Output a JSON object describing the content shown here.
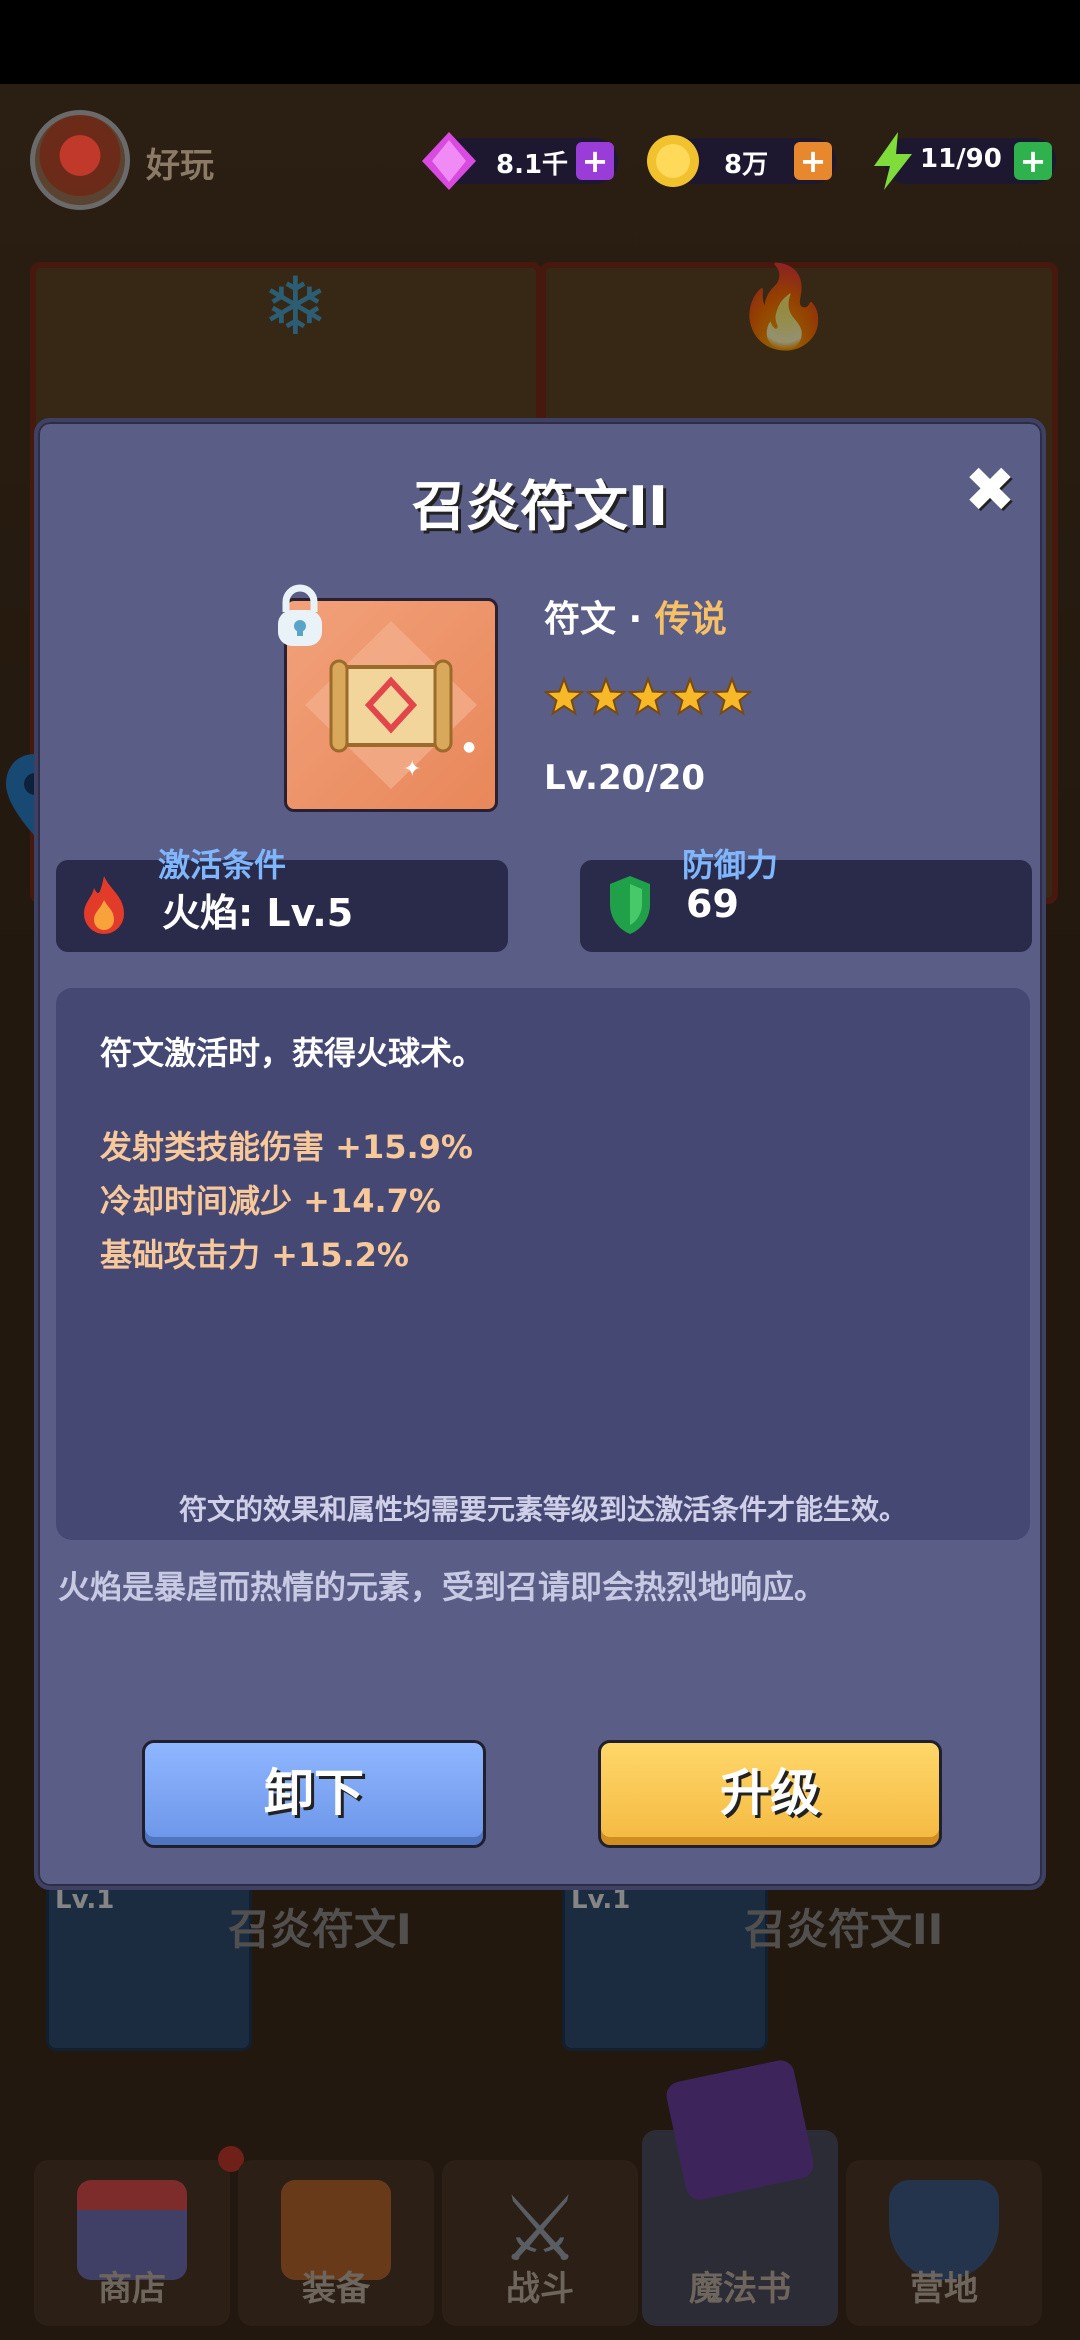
{
  "player": {
    "name": "好玩"
  },
  "resources": [
    {
      "name": "gems",
      "value": "8.1千",
      "icon": "gem-icon",
      "color": "#c93bd6",
      "plus_color": "#9a3cd8"
    },
    {
      "name": "gold",
      "value": "8万",
      "icon": "gold-coin-icon",
      "color": "#f2c12e",
      "plus_color": "#e8882e"
    },
    {
      "name": "energy",
      "value": "11/90",
      "icon": "lightning-icon",
      "color": "#7fdc3a",
      "plus_color": "#2fb14d"
    }
  ],
  "modal": {
    "title": "召炎符文II",
    "close_label": "✖",
    "rune_type": "符文 · ",
    "rarity": "传说",
    "stars": 5,
    "level": "Lv.20/20",
    "activation": {
      "label": "激活条件",
      "value": "火焰: Lv.5"
    },
    "defense": {
      "label": "防御力",
      "value": "69"
    },
    "description": "符文激活时，获得火球术。",
    "bonuses": [
      "发射类技能伤害 +15.9%",
      "冷却时间减少 +14.7%",
      "基础攻击力 +15.2%"
    ],
    "note": "符文的效果和属性均需要元素等级到达激活条件才能生效。",
    "flavor": "火焰是暴虐而热情的元素，受到召请即会热烈地响应。",
    "unequip_label": "卸下",
    "upgrade_label": "升级"
  },
  "background_cards": [
    {
      "level": "Lv.1",
      "title": "召炎符文I"
    },
    {
      "level": "Lv.1",
      "title": "召炎符文II"
    }
  ],
  "nav": [
    {
      "label": "商店"
    },
    {
      "label": "装备"
    },
    {
      "label": "战斗"
    },
    {
      "label": "魔法书"
    },
    {
      "label": "营地"
    }
  ],
  "colors": {
    "accent_blue": "#7fb7ff",
    "rarity_gold": "#f6c067",
    "bonus_text": "#f6c89a"
  }
}
